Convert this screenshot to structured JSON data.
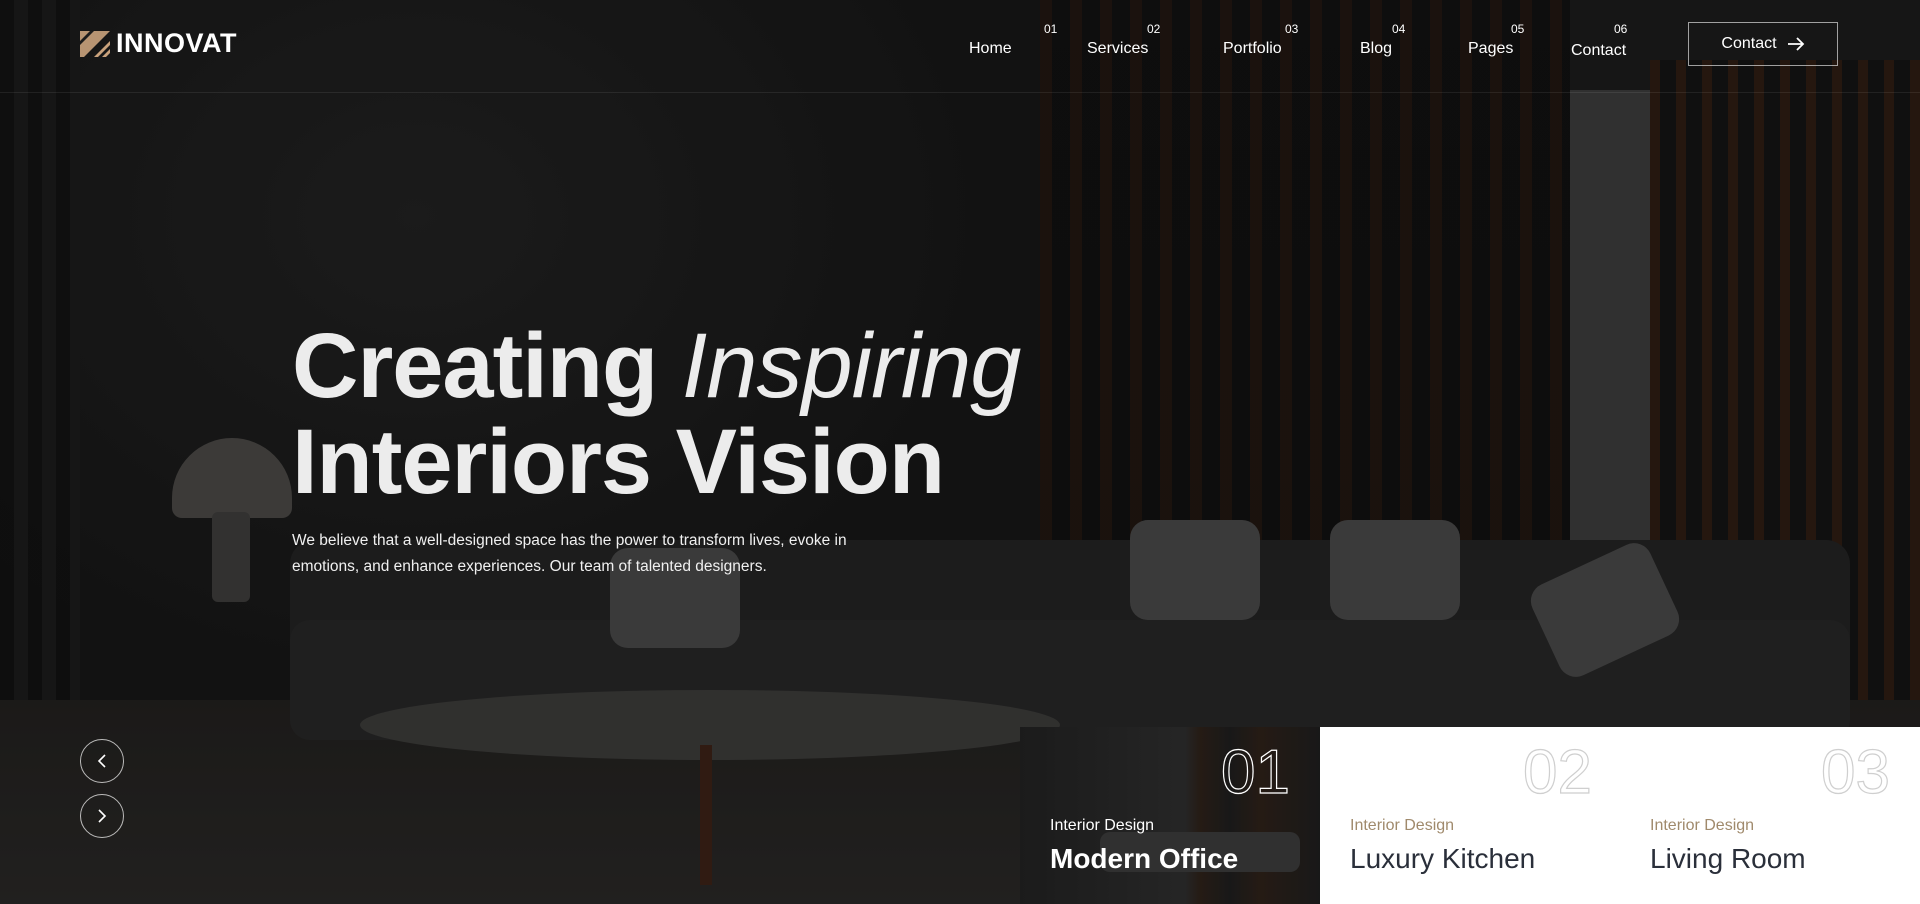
{
  "brand": {
    "name": "INNOVAT",
    "logo_icon": "diagonal-stripes-logo-icon",
    "accent": "#c9a27c"
  },
  "nav": {
    "items": [
      {
        "num": "01",
        "label": "Home"
      },
      {
        "num": "02",
        "label": "Services"
      },
      {
        "num": "03",
        "label": "Portfolio"
      },
      {
        "num": "04",
        "label": "Blog"
      },
      {
        "num": "05",
        "label": "Pages"
      },
      {
        "num": "06",
        "label": "Contact"
      }
    ],
    "cta_label": "Contact",
    "cta_icon": "arrow-right-icon"
  },
  "hero": {
    "title_word1": "Creating",
    "title_word2": "Inspiring",
    "title_line2": "Interiors Vision",
    "description": "We believe that a well-designed space has the power to transform lives, evoke in emotions, and enhance experiences. Our team of talented designers."
  },
  "slider": {
    "prev_icon": "chevron-left-icon",
    "next_icon": "chevron-right-icon"
  },
  "cards": [
    {
      "num": "01",
      "category": "Interior Design",
      "title": "Modern Office"
    },
    {
      "num": "02",
      "category": "Interior Design",
      "title": "Luxury Kitchen"
    },
    {
      "num": "03",
      "category": "Interior Design",
      "title": "Living Room"
    }
  ]
}
